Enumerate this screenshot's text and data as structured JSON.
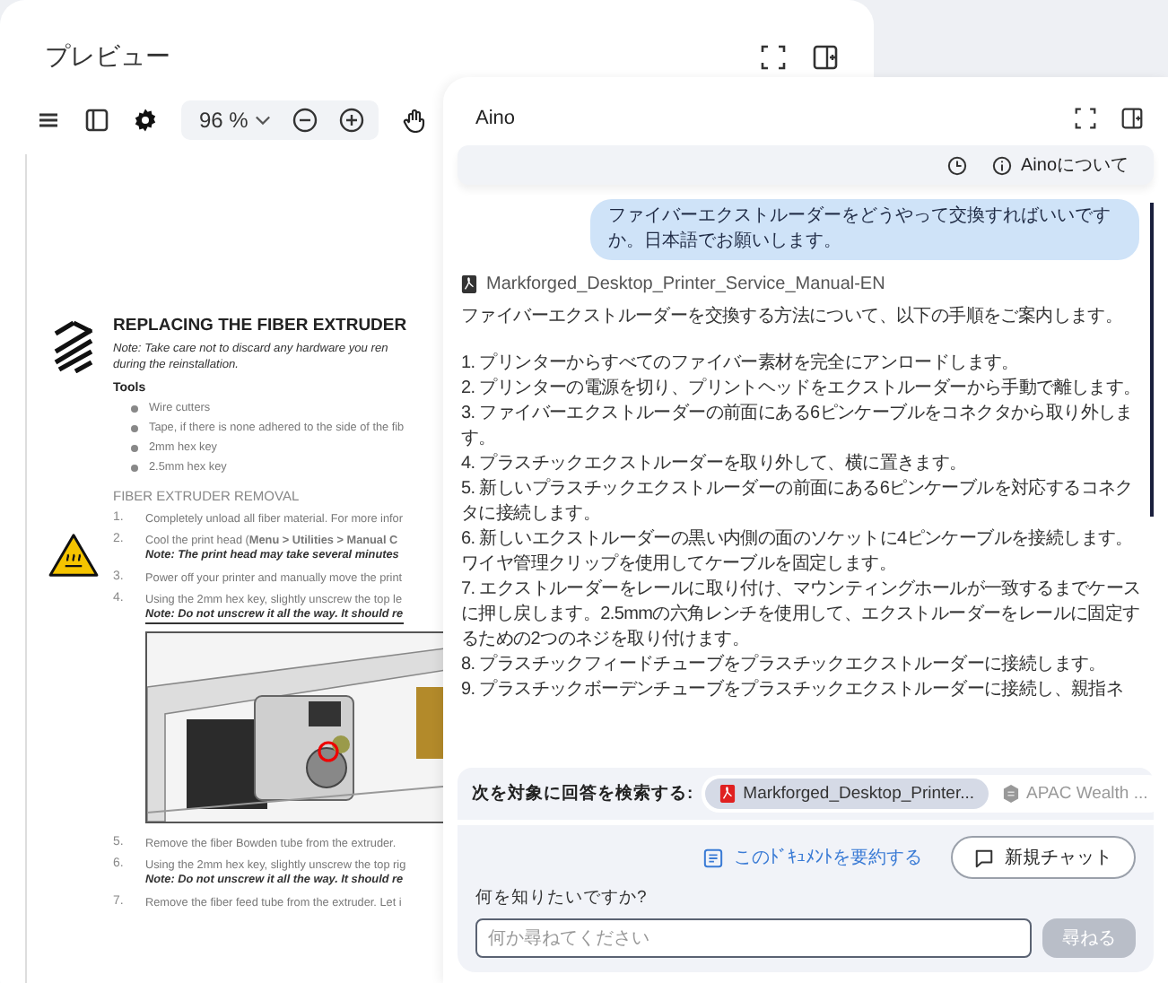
{
  "preview": {
    "title": "プレビュー",
    "zoom": "96 %",
    "document": {
      "heading": "REPLACING THE FIBER EXTRUDER",
      "note_lines": [
        "Note: Take care not to discard any hardware you ren",
        "during the reinstallation."
      ],
      "tools_heading": "Tools",
      "tools": [
        "Wire cutters",
        "Tape, if there is none adhered to the side of the fib",
        "2mm hex key",
        "2.5mm hex key"
      ],
      "section_heading": "FIBER EXTRUDER REMOVAL",
      "steps": [
        {
          "kind": "step",
          "number": "1.",
          "text": "Completely unload all fiber material. For more infor"
        },
        {
          "kind": "step",
          "number": "2.",
          "text": "Cool the print head (**Menu > Utilities > Manual C**",
          "note": "Note: The print head may take several minutes",
          "note_underlined": false
        },
        {
          "kind": "step",
          "number": "3.",
          "text": "Power off your printer and manually move the print"
        },
        {
          "kind": "step",
          "number": "4.",
          "text": "Using the 2mm hex key, slightly unscrew the top le",
          "note": "Note: Do not unscrew it all the way. It should re",
          "note_underlined": true
        },
        {
          "kind": "figure"
        },
        {
          "kind": "step",
          "number": "5.",
          "text": "Remove the fiber Bowden tube from the extruder."
        },
        {
          "kind": "step",
          "number": "6.",
          "text": "Using the 2mm hex key, slightly unscrew the top rig",
          "note": "Note: Do not unscrew it all the way. It should re",
          "note_underlined": false
        },
        {
          "kind": "step",
          "number": "7.",
          "text": "Remove the fiber feed tube from the extruder. Let i"
        }
      ]
    }
  },
  "assistant": {
    "title": "Aino",
    "about": "Ainoについて",
    "question": "ファイバーエクストルーダーをどうやって交換すればいいですか。日本語でお願いします。",
    "source": "Markforged_Desktop_Printer_Service_Manual-EN",
    "intro": "ファイバーエクストルーダーを交換する方法について、以下の手順をご案内します。",
    "steps": [
      "1. プリンターからすべてのファイバー素材を完全にアンロードします。",
      "2. プリンターの電源を切り、プリントヘッドをエクストルーダーから手動で離します。",
      "3. ファイバーエクストルーダーの前面にある6ピンケーブルをコネクタから取り外します。",
      "4. プラスチックエクストルーダーを取り外して、横に置きます。",
      "5. 新しいプラスチックエクストルーダーの前面にある6ピンケーブルを対応するコネクタに接続します。",
      "6. 新しいエクストルーダーの黒い内側の面のソケットに4ピンケーブルを接続します。ワイヤ管理クリップを使用してケーブルを固定します。",
      "7. エクストルーダーをレールに取り付け、マウンティングホールが一致するまでケースに押し戻します。2.5mmの六角レンチを使用して、エクストルーダーをレールに固定するための2つのネジを取り付けます。",
      "8. プラスチックフィードチューブをプラスチックエクストルーダーに接続します。",
      "9. プラスチックボーデンチューブをプラスチックエクストルーダーに接続し、親指ネ"
    ],
    "search_label": "次を対象に回答を検索する:",
    "sources": [
      {
        "label": "Markforged_Desktop_Printer...",
        "kind": "pdf",
        "selected": true
      },
      {
        "label": "APAC Wealth ...",
        "kind": "generic",
        "selected": false
      }
    ],
    "summarize": "このﾄﾞｷｭﾒﾝﾄを要約する",
    "new_chat": "新規チャット",
    "ask_label": "何を知りたいですか?",
    "placeholder": "何か尋ねてください",
    "ask_button": {
      "label": "尋ねる",
      "disabled": true
    }
  }
}
